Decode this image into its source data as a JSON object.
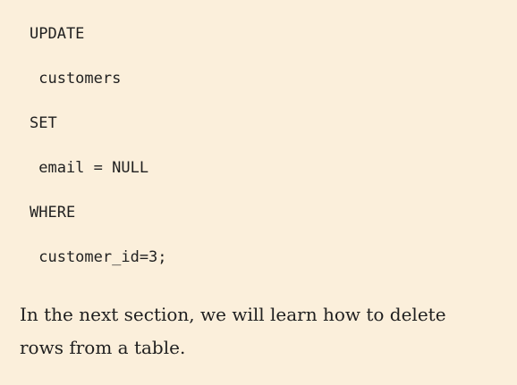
{
  "code": {
    "lines": [
      "UPDATE",
      " customers",
      "SET",
      " email = NULL",
      "WHERE",
      " customer_id=3;"
    ]
  },
  "prose": {
    "paragraph": "In the next section, we will learn how to delete rows from a table."
  }
}
